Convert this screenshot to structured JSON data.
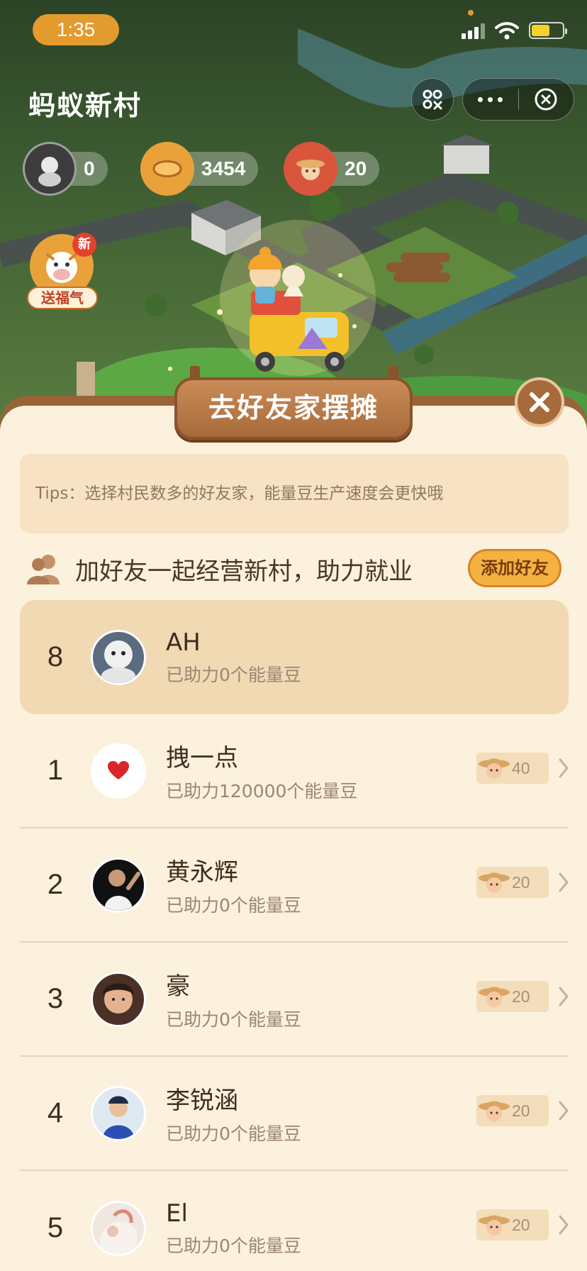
{
  "status_bar": {
    "time": "1:35"
  },
  "header": {
    "title": "蚂蚁新村"
  },
  "counters": [
    {
      "icon": "avatar-photo",
      "value": "0"
    },
    {
      "icon": "energy-bean-icon",
      "value": "3454"
    },
    {
      "icon": "villager-icon",
      "value": "20"
    }
  ],
  "fuqi": {
    "badge": "新",
    "label": "送福气"
  },
  "sheet": {
    "title": "去好友家摆摊",
    "tips": "Tips：选择村民数多的好友家，能量豆生产速度会更快哦",
    "invite_text": "加好友一起经营新村，助力就业",
    "add_friend_label": "添加好友"
  },
  "friends": [
    {
      "rank": "8",
      "name": "AH",
      "sub": "已助力0个能量豆",
      "self": true
    },
    {
      "rank": "1",
      "name": "拽一点",
      "sub": "已助力120000个能量豆",
      "villagers": "40"
    },
    {
      "rank": "2",
      "name": "黄永辉",
      "sub": "已助力0个能量豆",
      "villagers": "20"
    },
    {
      "rank": "3",
      "name": "豪",
      "sub": "已助力0个能量豆",
      "villagers": "20"
    },
    {
      "rank": "4",
      "name": "李锐涵",
      "sub": "已助力0个能量豆",
      "villagers": "20"
    },
    {
      "rank": "5",
      "name": "El",
      "sub": "已助力0个能量豆",
      "villagers": "20"
    }
  ],
  "colors": {
    "accent": "#e39b2e",
    "sheet_bg": "#fcf1dd",
    "wood": "#a86a3a"
  }
}
